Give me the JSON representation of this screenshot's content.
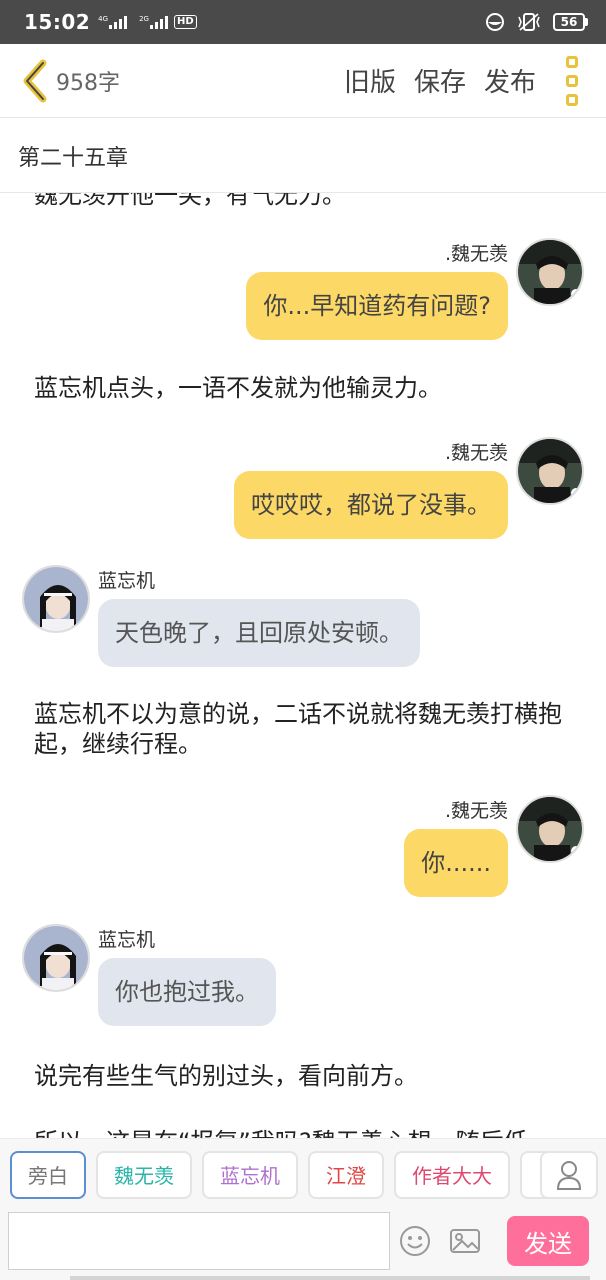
{
  "status_bar": {
    "time": "15:02",
    "net1": "4G",
    "net2": "2G",
    "hd": "HD",
    "battery": "56"
  },
  "header": {
    "word_count": "958字",
    "old_version": "旧版",
    "save": "保存",
    "publish": "发布"
  },
  "chapter": {
    "title": "第二十五章"
  },
  "messages": {
    "narr_clipped": "魏无羡开他一笑，有气无力。",
    "m1_name": ".魏无羡",
    "m1_text": "你...早知道药有问题?",
    "narr1": "蓝忘机点头，一语不发就为他输灵力。",
    "m2_name": ".魏无羡",
    "m2_text": "哎哎哎，都说了没事。",
    "m3_name": "蓝忘机",
    "m3_text": "天色晚了，且回原处安顿。",
    "narr2": "蓝忘机不以为意的说，二话不说就将魏无羡打横抱起，继续行程。",
    "m4_name": ".魏无羡",
    "m4_text": "你......",
    "m5_name": "蓝忘机",
    "m5_text": "你也抱过我。",
    "narr3": "说完有些生气的别过头，看向前方。",
    "narr_partial": "所以，这是在“报复”我吗?魏无羡心想，随后低"
  },
  "roles": [
    {
      "label": "旁白",
      "color": "#777777"
    },
    {
      "label": "魏无羡",
      "color": "#2bb5a8"
    },
    {
      "label": "蓝忘机",
      "color": "#b070d0"
    },
    {
      "label": "江澄",
      "color": "#e04848"
    },
    {
      "label": "作者大大",
      "color": "#e04870"
    }
  ],
  "composer": {
    "input_value": "",
    "send_label": "发送"
  },
  "colors": {
    "accent_yellow": "#fcd866",
    "bubble_grey": "#e1e6ee",
    "send_pink": "#ff6f9c",
    "menu_gold": "#e8c23a"
  }
}
